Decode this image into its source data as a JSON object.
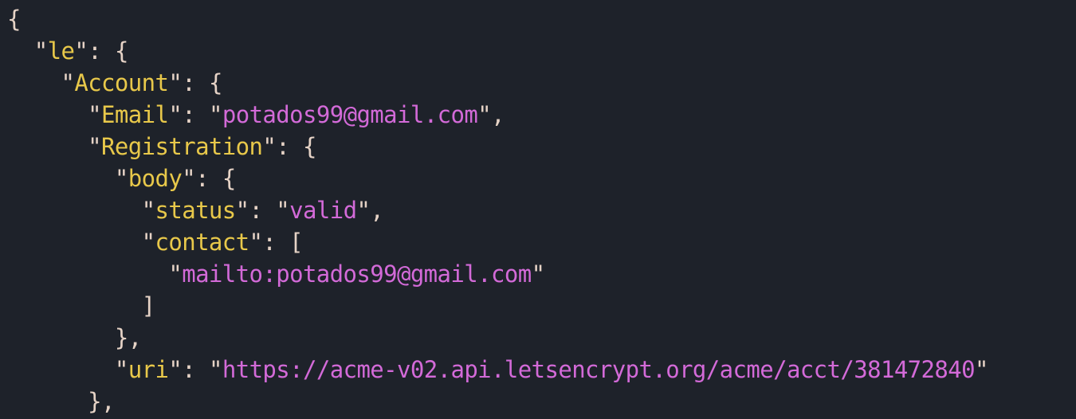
{
  "theme": {
    "background": "#1e222a",
    "punctuation_color": "#e6d3c6",
    "key_color": "#e8c84a",
    "string_color": "#d36ad8"
  },
  "lines": [
    {
      "indent": "",
      "key": null,
      "value": null,
      "tail": "{"
    },
    {
      "indent": "  ",
      "key": "le",
      "value": null,
      "tail": ": {"
    },
    {
      "indent": "    ",
      "key": "Account",
      "value": null,
      "tail": ": {"
    },
    {
      "indent": "      ",
      "key": "Email",
      "value": "potados99@gmail.com",
      "tail": ","
    },
    {
      "indent": "      ",
      "key": "Registration",
      "value": null,
      "tail": ": {"
    },
    {
      "indent": "        ",
      "key": "body",
      "value": null,
      "tail": ": {"
    },
    {
      "indent": "          ",
      "key": "status",
      "value": "valid",
      "tail": ","
    },
    {
      "indent": "          ",
      "key": "contact",
      "value": null,
      "tail": ": ["
    },
    {
      "indent": "            ",
      "key": null,
      "value": "mailto:potados99@gmail.com",
      "tail": ""
    },
    {
      "indent": "          ",
      "key": null,
      "value": null,
      "tail": "]"
    },
    {
      "indent": "        ",
      "key": null,
      "value": null,
      "tail": "},"
    },
    {
      "indent": "        ",
      "key": "uri",
      "value": "https://acme-v02.api.letsencrypt.org/acme/acct/381472840",
      "tail": ""
    },
    {
      "indent": "      ",
      "key": null,
      "value": null,
      "tail": "},"
    }
  ]
}
